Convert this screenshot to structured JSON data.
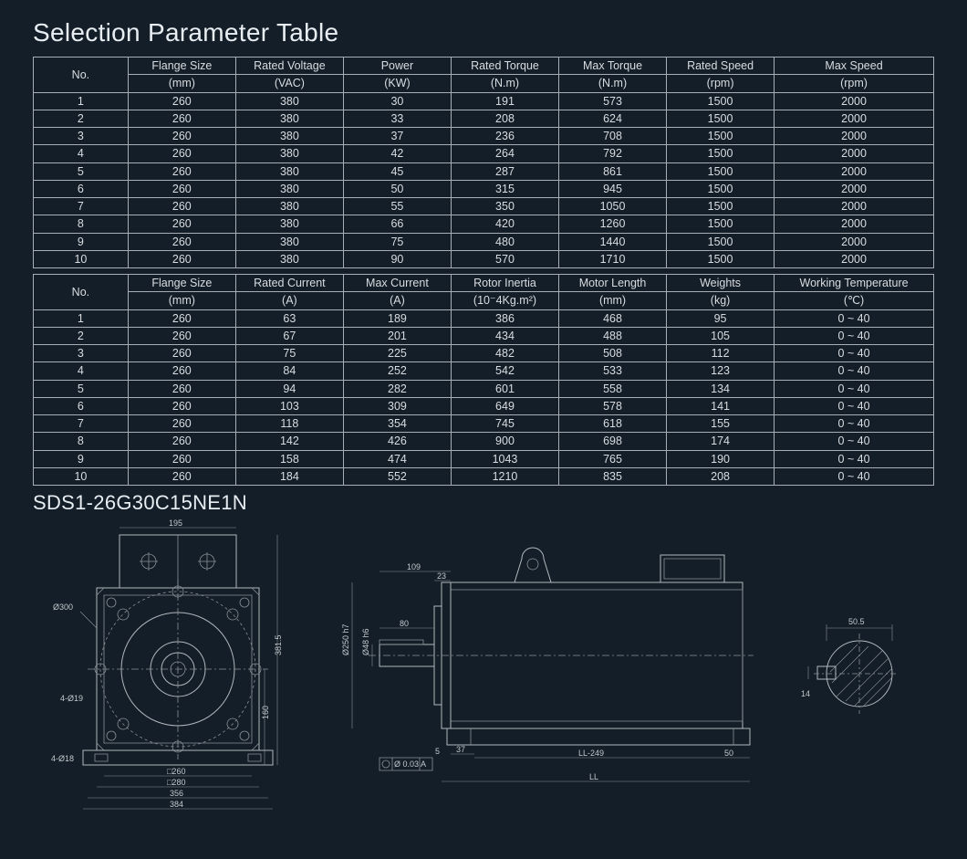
{
  "title": "Selection Parameter Table",
  "model": "SDS1-26G30C15NE1N",
  "table1": {
    "headers": [
      {
        "top": "No.",
        "bot": ""
      },
      {
        "top": "Flange Size",
        "bot": "(mm)"
      },
      {
        "top": "Rated Voltage",
        "bot": "(VAC)"
      },
      {
        "top": "Power",
        "bot": "(KW)"
      },
      {
        "top": "Rated Torque",
        "bot": "(N.m)"
      },
      {
        "top": "Max Torque",
        "bot": "(N.m)"
      },
      {
        "top": "Rated Speed",
        "bot": "(rpm)"
      },
      {
        "top": "Max Speed",
        "bot": "(rpm)"
      }
    ],
    "rows": [
      [
        "1",
        "260",
        "380",
        "30",
        "191",
        "573",
        "1500",
        "2000"
      ],
      [
        "2",
        "260",
        "380",
        "33",
        "208",
        "624",
        "1500",
        "2000"
      ],
      [
        "3",
        "260",
        "380",
        "37",
        "236",
        "708",
        "1500",
        "2000"
      ],
      [
        "4",
        "260",
        "380",
        "42",
        "264",
        "792",
        "1500",
        "2000"
      ],
      [
        "5",
        "260",
        "380",
        "45",
        "287",
        "861",
        "1500",
        "2000"
      ],
      [
        "6",
        "260",
        "380",
        "50",
        "315",
        "945",
        "1500",
        "2000"
      ],
      [
        "7",
        "260",
        "380",
        "55",
        "350",
        "1050",
        "1500",
        "2000"
      ],
      [
        "8",
        "260",
        "380",
        "66",
        "420",
        "1260",
        "1500",
        "2000"
      ],
      [
        "9",
        "260",
        "380",
        "75",
        "480",
        "1440",
        "1500",
        "2000"
      ],
      [
        "10",
        "260",
        "380",
        "90",
        "570",
        "1710",
        "1500",
        "2000"
      ]
    ]
  },
  "table2": {
    "headers": [
      {
        "top": "No.",
        "bot": ""
      },
      {
        "top": "Flange Size",
        "bot": "(mm)"
      },
      {
        "top": "Rated Current",
        "bot": "(A)"
      },
      {
        "top": "Max Current",
        "bot": "(A)"
      },
      {
        "top": "Rotor Inertia",
        "bot": "(10⁻4Kg.m²)"
      },
      {
        "top": "Motor Length",
        "bot": "(mm)"
      },
      {
        "top": "Weights",
        "bot": "(kg)"
      },
      {
        "top": "Working Temperature",
        "bot": "(℃)"
      }
    ],
    "rows": [
      [
        "1",
        "260",
        "63",
        "189",
        "386",
        "468",
        "95",
        "0 ~ 40"
      ],
      [
        "2",
        "260",
        "67",
        "201",
        "434",
        "488",
        "105",
        "0 ~ 40"
      ],
      [
        "3",
        "260",
        "75",
        "225",
        "482",
        "508",
        "112",
        "0 ~ 40"
      ],
      [
        "4",
        "260",
        "84",
        "252",
        "542",
        "533",
        "123",
        "0 ~ 40"
      ],
      [
        "5",
        "260",
        "94",
        "282",
        "601",
        "558",
        "134",
        "0 ~ 40"
      ],
      [
        "6",
        "260",
        "103",
        "309",
        "649",
        "578",
        "141",
        "0 ~ 40"
      ],
      [
        "7",
        "260",
        "118",
        "354",
        "745",
        "618",
        "155",
        "0 ~ 40"
      ],
      [
        "8",
        "260",
        "142",
        "426",
        "900",
        "698",
        "174",
        "0 ~ 40"
      ],
      [
        "9",
        "260",
        "158",
        "474",
        "1043",
        "765",
        "190",
        "0 ~ 40"
      ],
      [
        "10",
        "260",
        "184",
        "552",
        "1210",
        "835",
        "208",
        "0 ~ 40"
      ]
    ]
  },
  "drawing": {
    "front": {
      "d300": "Ø300",
      "d195": "195",
      "d260": "□260",
      "d280": "□280",
      "d356": "356",
      "d384": "384",
      "h381": "381.5",
      "h160": "160",
      "hole19": "4-Ø19",
      "hole18": "4-Ø18"
    },
    "side": {
      "d250": "Ø250 h7",
      "d48": "Ø48 h6",
      "l80": "80",
      "l109": "109",
      "l23": "23",
      "l37": "37",
      "l5": "5",
      "ll": "LL",
      "ll249": "LL-249",
      "l50": "50",
      "tol": "Ø 0.03 A"
    },
    "shaft": {
      "w": "50.5",
      "h": "14"
    }
  }
}
